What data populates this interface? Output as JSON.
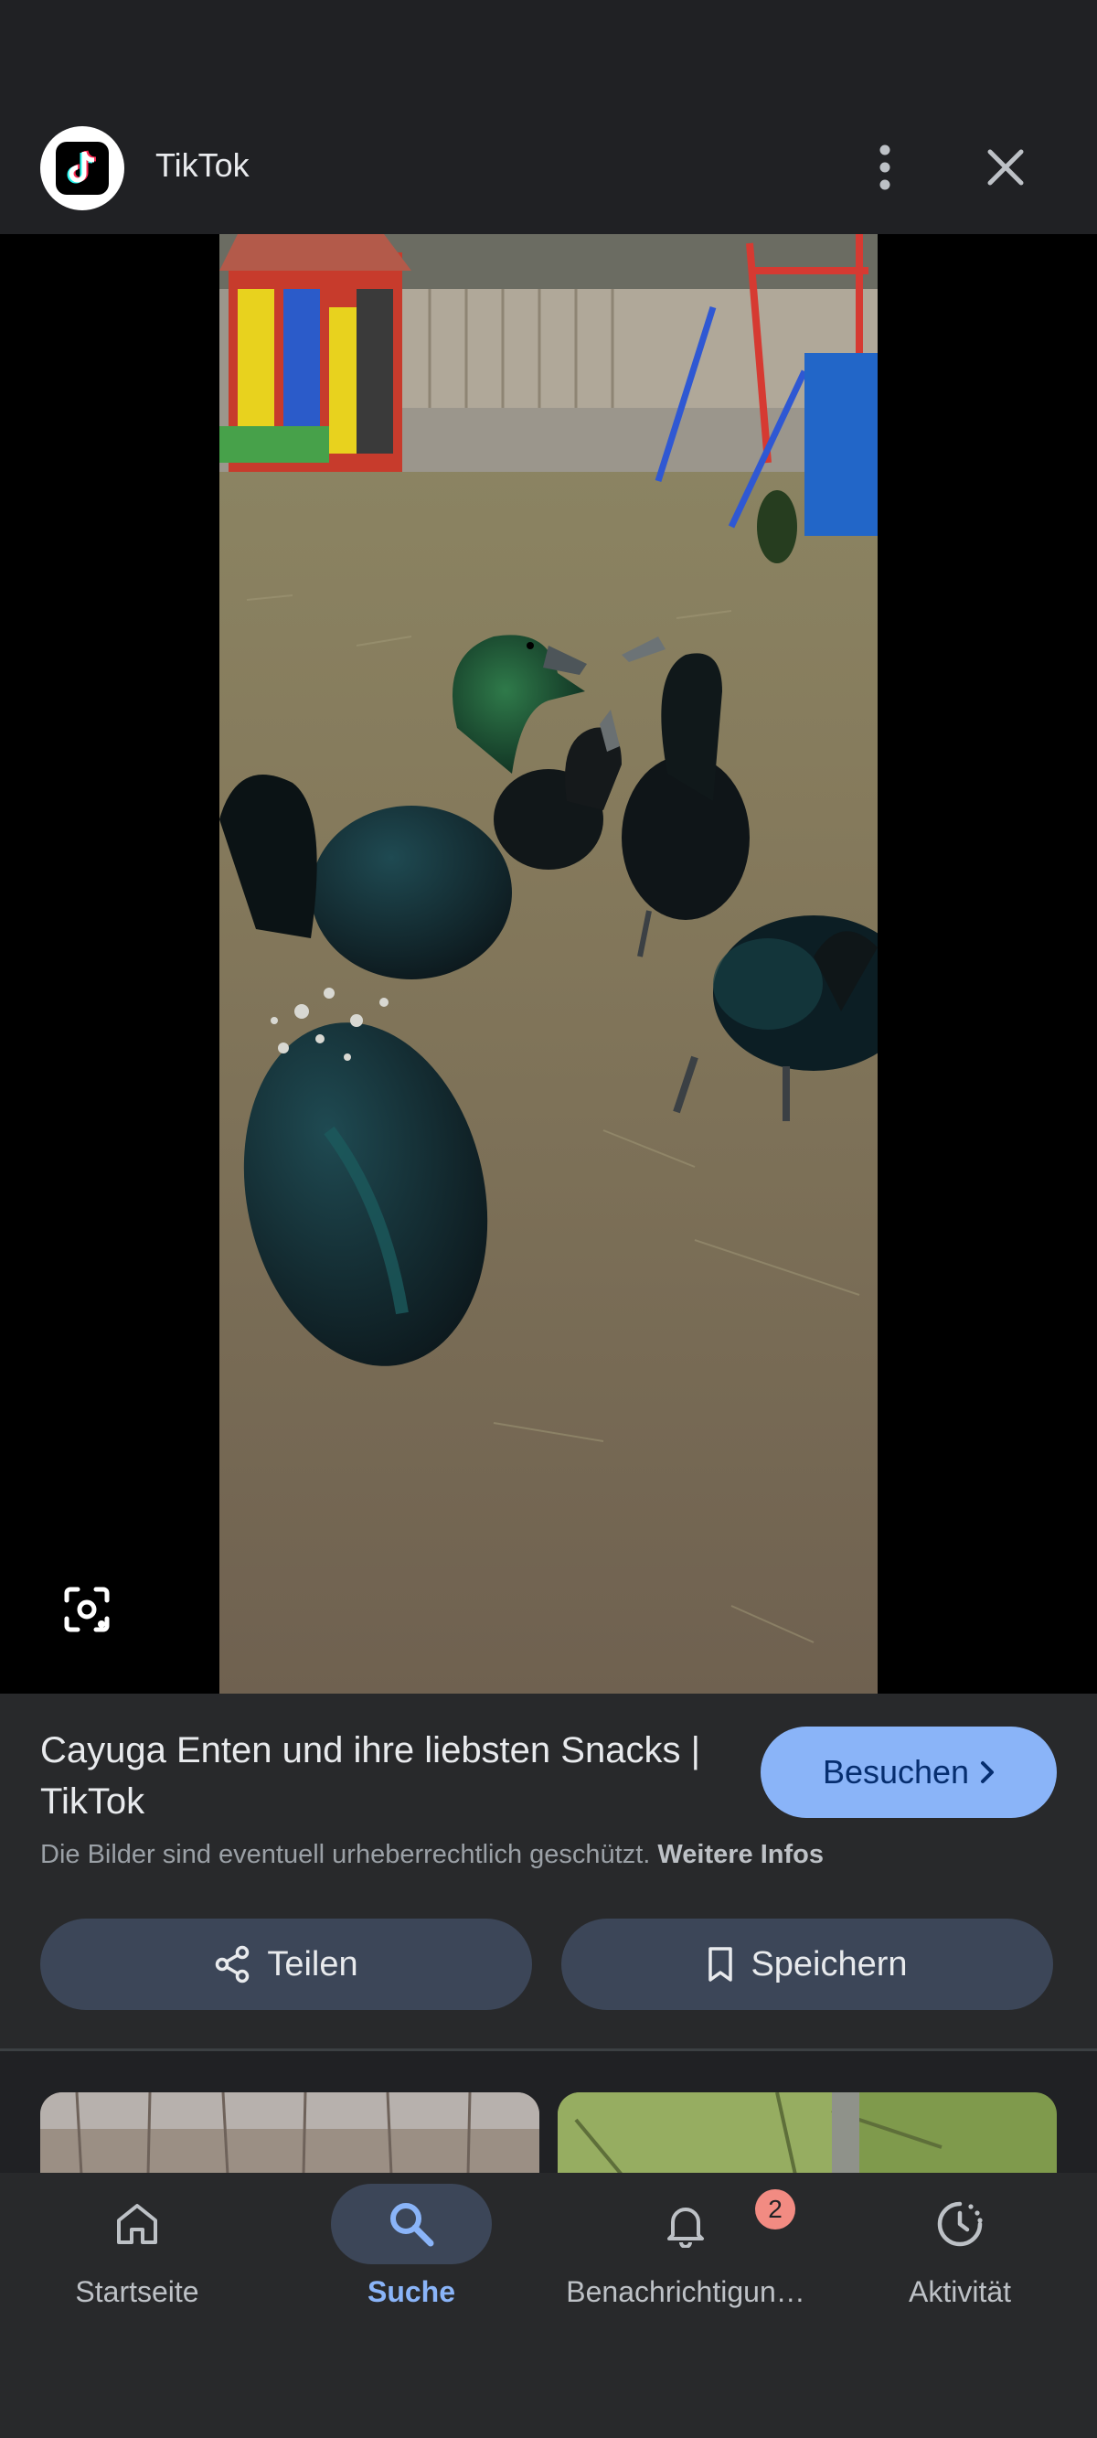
{
  "header": {
    "site_name": "TikTok"
  },
  "result": {
    "title": "Cayuga Enten und ihre liebsten Snacks | TikTok",
    "visit_label": "Besuchen",
    "copyright_text": "Die Bilder sind eventuell urheberrechtlich geschützt.",
    "more_info_label": "Weitere Infos",
    "share_label": "Teilen",
    "save_label": "Speichern"
  },
  "bottom_nav": {
    "items": [
      {
        "label": "Startseite",
        "icon": "home-icon"
      },
      {
        "label": "Suche",
        "icon": "search-icon",
        "active": true
      },
      {
        "label": "Benachrichtigun…",
        "icon": "bell-icon",
        "badge": "2"
      },
      {
        "label": "Aktivität",
        "icon": "activity-icon"
      }
    ]
  },
  "colors": {
    "accent": "#8ab4f8",
    "background": "#202124",
    "panel": "#28292b",
    "chip": "#3c4658",
    "badge": "#f28b82"
  }
}
